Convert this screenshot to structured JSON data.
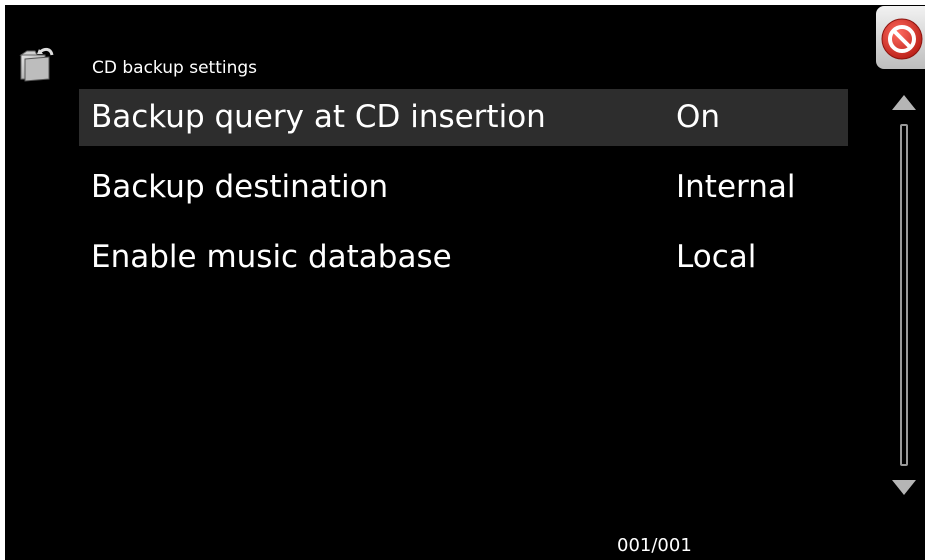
{
  "header": {
    "title": "CD backup settings",
    "back_icon": "folder-back-icon",
    "close_icon": "no-entry-icon"
  },
  "settings": [
    {
      "label": "Backup query at CD insertion",
      "value": "On",
      "selected": true
    },
    {
      "label": "Backup destination",
      "value": "Internal",
      "selected": false
    },
    {
      "label": "Enable music database",
      "value": "Local",
      "selected": false
    }
  ],
  "scrollbar": {
    "up_icon": "triangle-up-icon",
    "down_icon": "triangle-down-icon"
  },
  "pagination": {
    "text": "001/001"
  },
  "colors": {
    "background": "#000000",
    "selected_row": "#2d2d2d",
    "text": "#ffffff",
    "close_red": "#d9342b"
  }
}
